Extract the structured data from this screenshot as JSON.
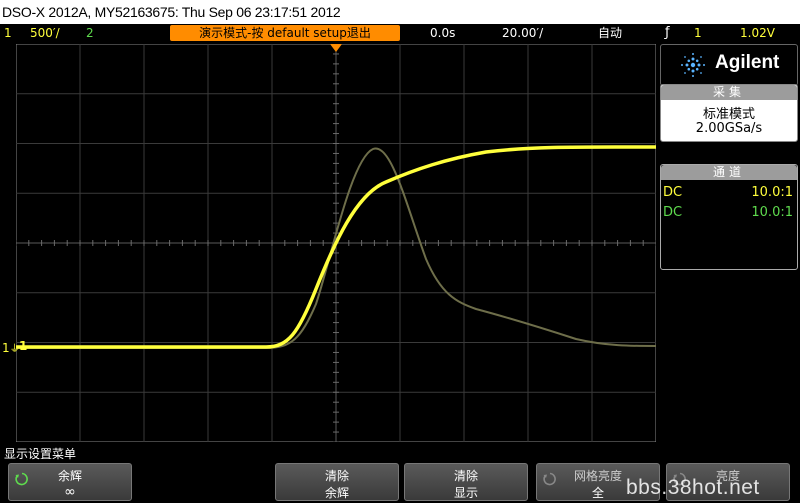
{
  "title_bar": {
    "text": "DSO-X 2012A, MY52163675: Thu Sep 06 23:17:51 2012"
  },
  "status_bar": {
    "ch1_number": "1",
    "ch1_scale": "500′/",
    "ch2_number": "2",
    "message": "演示模式-按 default setup退出",
    "time_delay": "0.0s",
    "time_scale": "20.00′/",
    "trigger_mode": "自动",
    "trigger_edge": "ƒ",
    "trigger_source": "1",
    "trigger_level": "1.02V"
  },
  "scope": {
    "trigger_marker": "T",
    "ch1_ground_marker": "1",
    "ch1_ground_marker_right": "1"
  },
  "right_panel": {
    "brand": "Agilent",
    "acquire": {
      "header": "采集",
      "mode": "标准模式",
      "sample_rate": "2.00GSa/s"
    },
    "channels": {
      "header": "通道",
      "rows": [
        {
          "coupling": "DC",
          "probe": "10.0:1"
        },
        {
          "coupling": "DC",
          "probe": "10.0:1"
        }
      ]
    }
  },
  "menu": {
    "title": "显示设置菜单",
    "softkeys": [
      {
        "line1": "余辉",
        "line2": "∞"
      },
      {
        "line1": "清除",
        "line2": "余辉"
      },
      {
        "line1": "清除",
        "line2": "显示"
      },
      {
        "line1": "网格亮度",
        "line2": "全"
      },
      {
        "line1": "亮度",
        "line2": ""
      }
    ]
  },
  "watermark": "bbs.38hot.net",
  "colors": {
    "ch1": "#ffff3c",
    "ch2": "#5fdb4e",
    "status_pill": "#ff8c00",
    "ch2_trace": "#6e6e4a"
  }
}
